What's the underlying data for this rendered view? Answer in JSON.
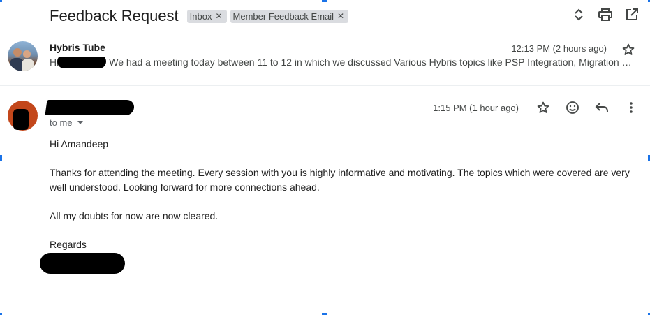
{
  "thread": {
    "subject": "Feedback Request",
    "labels": [
      {
        "name": "Inbox",
        "remove_icon": "close-icon"
      },
      {
        "name": "Member Feedback Email",
        "remove_icon": "close-icon"
      }
    ],
    "toolbar_icons": [
      "expand-collapse-icon",
      "print-icon",
      "open-new-window-icon"
    ]
  },
  "messages": [
    {
      "sender": "Hybris Tube",
      "snippet_prefix": "Hi",
      "snippet": "We had a meeting today between 11 to 12 in which we discussed Various Hybris topics like PSP Integration, Migration ste...",
      "time": "12:13 PM (2 hours ago)",
      "star_icon": "star-icon"
    },
    {
      "sender": "",
      "recipient": "to me",
      "time": "1:15 PM (1 hour ago)",
      "action_icons": [
        "star-icon",
        "emoji-reaction-icon",
        "reply-icon",
        "more-options-icon"
      ],
      "avatar_color": "#c3471b",
      "body": {
        "greeting": "Hi Amandeep",
        "paragraph_1": "Thanks for attending the meeting. Every session with you is highly informative and motivating. The topics which were covered are very well understood. Looking forward for more connections ahead.",
        "paragraph_2": "All my doubts for now are now cleared.",
        "closing": "Regards"
      }
    }
  ],
  "colors": {
    "label_chip_bg": "#dadce0",
    "selection_handle": "#1a73e8"
  }
}
